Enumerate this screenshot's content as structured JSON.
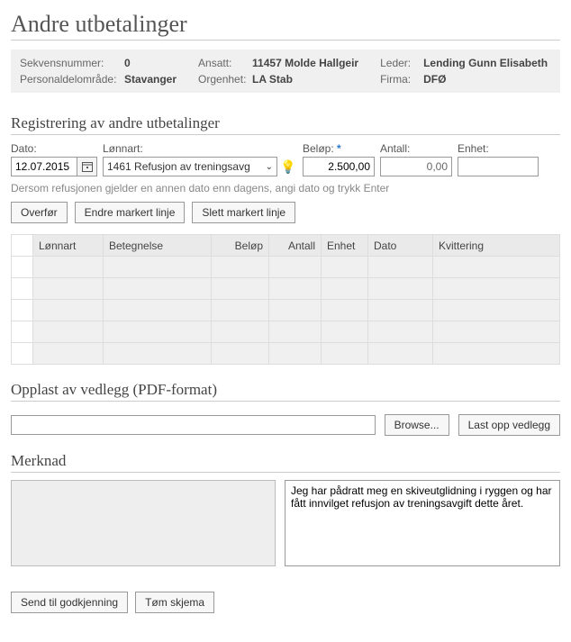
{
  "title": "Andre utbetalinger",
  "info": {
    "sekvensnummer_label": "Sekvensnummer:",
    "sekvensnummer": "0",
    "personalomrade_label": "Personaldelområde:",
    "personalomrade": "Stavanger",
    "ansatt_label": "Ansatt:",
    "ansatt": "11457 Molde Hallgeir",
    "orgenhet_label": "Orgenhet:",
    "orgenhet": "LA Stab",
    "leder_label": "Leder:",
    "leder": "Lending Gunn Elisabeth",
    "firma_label": "Firma:",
    "firma": "DFØ"
  },
  "section_form_title": "Registrering av andre utbetalinger",
  "form": {
    "dato_label": "Dato:",
    "dato": "12.07.2015",
    "lonnart_label": "Lønnart:",
    "lonnart_selected": "1461 Refusjon av treningsavg",
    "belop_label": "Beløp:",
    "belop": "2.500,00",
    "antall_label": "Antall:",
    "antall": "0,00",
    "enhet_label": "Enhet:",
    "enhet": "",
    "hint": "Dersom refusjonen gjelder en annen dato enn dagens, angi dato og trykk Enter"
  },
  "buttons": {
    "overfor": "Overfør",
    "endre": "Endre markert linje",
    "slett": "Slett markert linje",
    "browse": "Browse...",
    "lastopp": "Last opp vedlegg",
    "send": "Send til godkjenning",
    "tom": "Tøm skjema"
  },
  "grid": {
    "headers": {
      "lonnart": "Lønnart",
      "betegnelse": "Betegnelse",
      "belop": "Beløp",
      "antall": "Antall",
      "enhet": "Enhet",
      "dato": "Dato",
      "kvittering": "Kvittering"
    },
    "row_count": 5
  },
  "section_upload_title": "Opplast av vedlegg (PDF-format)",
  "upload_path": "",
  "section_merknad_title": "Merknad",
  "merknad_text": "Jeg har pådratt meg en skiveutglidning i ryggen og har fått innvilget refusjon av treningsavgift dette året."
}
